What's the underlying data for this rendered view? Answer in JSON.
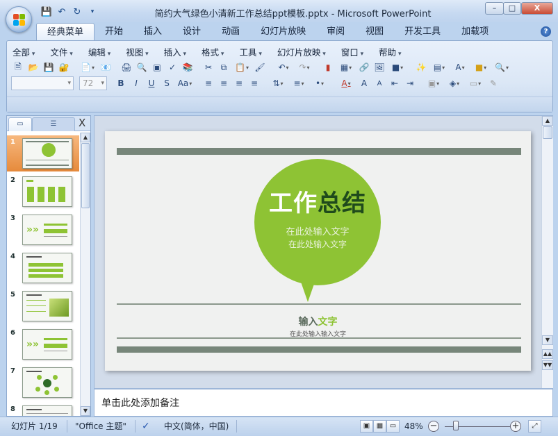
{
  "window": {
    "title": "简约大气绿色小清新工作总结ppt模板.pptx - Microsoft PowerPoint",
    "minimize": "–",
    "maximize": "□",
    "close": "X"
  },
  "quick_access": [
    "save-icon",
    "undo-icon",
    "redo-icon",
    "customize-icon"
  ],
  "tabs": [
    "经典菜单",
    "开始",
    "插入",
    "设计",
    "动画",
    "幻灯片放映",
    "审阅",
    "视图",
    "开发工具",
    "加载项"
  ],
  "active_tab": "经典菜单",
  "help": "?",
  "menubar": [
    "全部",
    "文件",
    "编辑",
    "视图",
    "插入",
    "格式",
    "工具",
    "幻灯片放映",
    "窗口",
    "帮助"
  ],
  "toolbar": {
    "font_name": "",
    "font_size": "72"
  },
  "left_panel": {
    "close": "X",
    "thumbnails": [
      "1",
      "2",
      "3",
      "4",
      "5",
      "6",
      "7",
      "8"
    ],
    "selected": 1
  },
  "slide": {
    "title_white": "工作",
    "title_dark": "总结",
    "subtitle_1": "在此处输入文字",
    "subtitle_2": "在此处输入文字",
    "input_a": "输入",
    "input_b": "文字",
    "small_text": "在此处输入输入文字"
  },
  "colors": {
    "accent_green": "#8ec334",
    "bar_gray": "#77867a",
    "title_dark_green": "#1f4a1c",
    "selection_orange": "#e68a3b"
  },
  "notes": {
    "placeholder": "单击此处添加备注"
  },
  "status": {
    "slide_position": "幻灯片 1/19",
    "theme": "\"Office 主题\"",
    "language": "中文(简体，中国)",
    "zoom": "48%"
  }
}
